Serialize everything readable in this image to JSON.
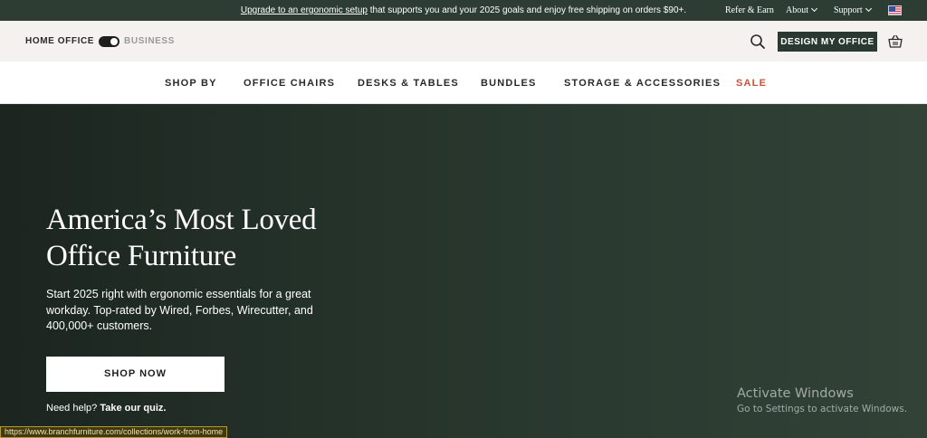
{
  "announcement": {
    "link_text": "Upgrade to an ergonomic setup",
    "rest_text": " that supports you and your 2025 goals and enjoy free shipping on orders $90+."
  },
  "utility_nav": {
    "refer": "Refer & Earn",
    "about": "About",
    "support": "Support",
    "flag_icon": "us-flag-icon"
  },
  "header": {
    "segment_home": "HOME OFFICE",
    "segment_business": "BUSINESS",
    "search_icon": "search-icon",
    "design_button": "DESIGN MY OFFICE",
    "cart_icon": "cart-icon"
  },
  "nav": {
    "items": [
      {
        "label": "SHOP BY"
      },
      {
        "label": "OFFICE CHAIRS"
      },
      {
        "label": "DESKS & TABLES"
      },
      {
        "label": "BUNDLES"
      },
      {
        "label": "STORAGE & ACCESSORIES"
      },
      {
        "label": "SALE"
      }
    ]
  },
  "hero": {
    "title_line1": "America’s Most Loved",
    "title_line2": "Office Furniture",
    "subtitle": "Start 2025 right with ergonomic essentials for a great workday. Top-rated by Wired, Forbes, Wirecutter, and 400,000+ customers.",
    "shop_button": "SHOP NOW",
    "help_prefix": "Need help? ",
    "help_link": "Take our quiz."
  },
  "os_watermark": {
    "title": "Activate Windows",
    "subtitle": "Go to Settings to activate Windows."
  },
  "status_url": "https://www.branchfurniture.com/collections/work-from-home",
  "colors": {
    "brand_green": "#2b3a31",
    "sale_red": "#c8553d",
    "header_bg": "#f4f1ee"
  }
}
